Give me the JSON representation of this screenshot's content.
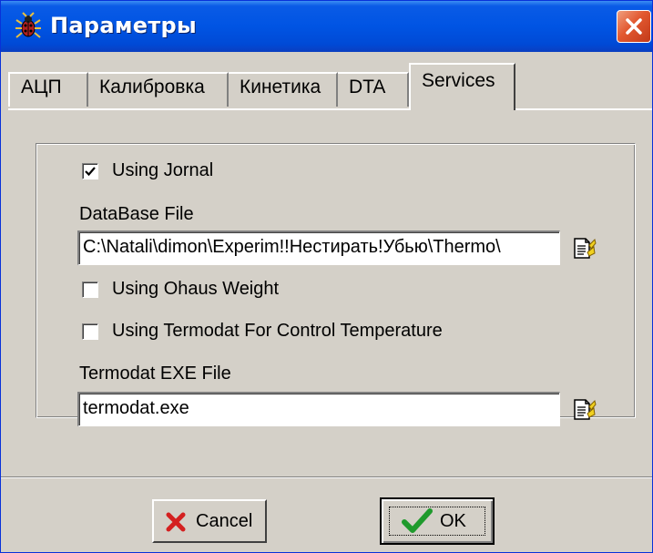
{
  "window": {
    "title": "Параметры"
  },
  "tabs": [
    {
      "label": "АЦП",
      "active": false
    },
    {
      "label": "Калибровка",
      "active": false
    },
    {
      "label": "Кинетика",
      "active": false
    },
    {
      "label": "DTA",
      "active": false
    },
    {
      "label": "Services",
      "active": true
    }
  ],
  "services": {
    "using_journal": {
      "label": "Using Jornal",
      "checked": true
    },
    "database_file": {
      "label": "DataBase File",
      "value": "C:\\Natali\\dimon\\Experim!!Нестирать!Убью\\Thermo\\"
    },
    "using_ohaus": {
      "label": "Using Ohaus Weight",
      "checked": false
    },
    "using_termodat": {
      "label": "Using Termodat For Control Temperature",
      "checked": false
    },
    "termodat_exe": {
      "label": "Termodat EXE File",
      "value": "termodat.exe"
    }
  },
  "buttons": {
    "cancel": "Cancel",
    "ok": "OK"
  },
  "icons": {
    "app": "bug-icon",
    "close": "close-icon",
    "browse": "document-browse-icon",
    "cancel": "red-x-icon",
    "ok": "green-check-icon"
  },
  "colors": {
    "titlebar": "#0054e3",
    "dialog_face": "#d4d0c8",
    "close_button": "#e2582f",
    "cancel_x": "#d42020",
    "ok_check": "#1f9a2c"
  }
}
